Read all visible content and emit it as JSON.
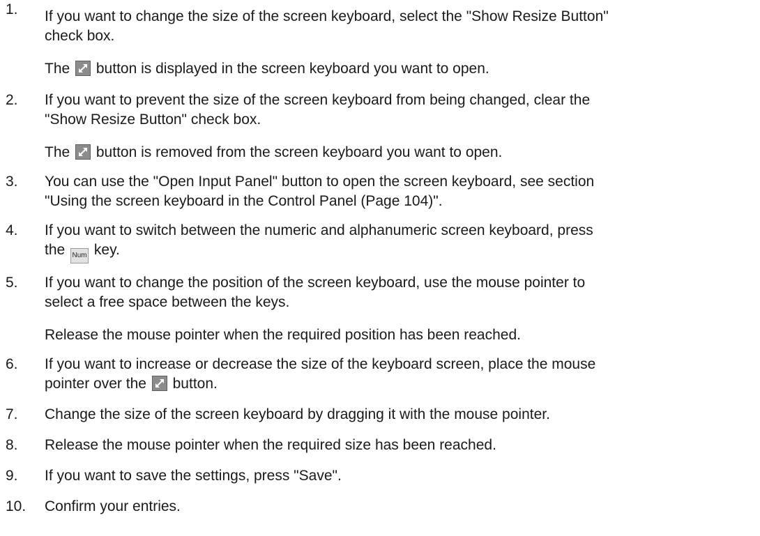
{
  "steps": [
    {
      "number": "1.",
      "lines": [
        "If you want to change the size of the screen keyboard, select the \"Show Resize Button\"",
        "check box."
      ],
      "note_before": "The",
      "note_after": "button is displayed in the screen keyboard you want to open."
    },
    {
      "number": "2.",
      "lines": [
        "If you want to prevent the size of the screen keyboard from being changed, clear the",
        "\"Show Resize Button\" check box."
      ],
      "note_before": "The",
      "note_after": "button is removed from the screen keyboard you want to open."
    },
    {
      "number": "3.",
      "lines": [
        "You can use the \"Open Input Panel\" button to open the screen keyboard, see section",
        "\"Using the screen keyboard in the Control Panel (Page 104)\"."
      ]
    },
    {
      "number": "4.",
      "lines": [
        "If you want to switch between the numeric and alphanumeric screen keyboard, press"
      ],
      "line2_before": "the",
      "line2_after": "key.",
      "key_label": "Num"
    },
    {
      "number": "5.",
      "lines": [
        "If you want to change the position of the screen keyboard, use the mouse pointer to",
        "select a free space between the keys."
      ],
      "note": "Release the mouse pointer when the required position has been reached."
    },
    {
      "number": "6.",
      "lines": [
        "If you want to increase or decrease the size of the keyboard screen, place the mouse"
      ],
      "line2_before": "pointer over the",
      "line2_after": "button."
    },
    {
      "number": "7.",
      "lines": [
        "Change the size of the screen keyboard by dragging it with the mouse pointer."
      ]
    },
    {
      "number": "8.",
      "lines": [
        "Release the mouse pointer when the required size has been reached."
      ]
    },
    {
      "number": "9.",
      "lines": [
        "If you want to save the settings, press \"Save\"."
      ]
    },
    {
      "number": "10.",
      "lines": [
        "Confirm your entries."
      ]
    }
  ],
  "icons": {
    "resize": "resize-arrow-icon",
    "resize_color": "#8c8c8c",
    "num_key_color": "#e2e2e2"
  }
}
